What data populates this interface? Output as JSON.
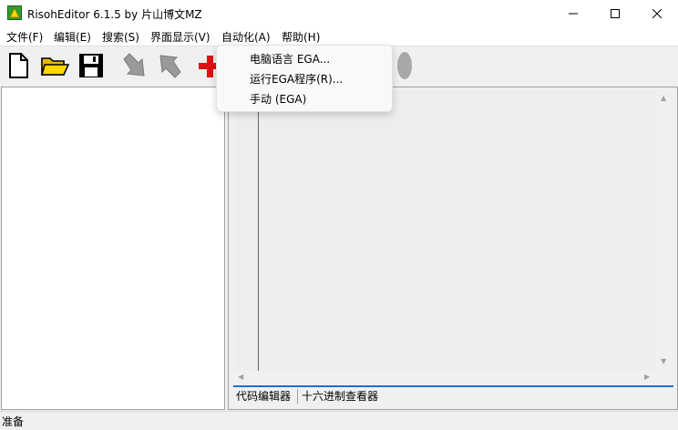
{
  "window": {
    "title": "RisohEditor 6.1.5 by 片山博文MZ",
    "icon": "app-icon",
    "controls": [
      "minimize-icon",
      "maximize-icon",
      "close-icon"
    ]
  },
  "menubar": {
    "items": [
      {
        "label": "文件(F)"
      },
      {
        "label": "编辑(E)"
      },
      {
        "label": "搜索(S)"
      },
      {
        "label": "界面显示(V)"
      },
      {
        "label": "自动化(A)"
      },
      {
        "label": "帮助(H)"
      }
    ]
  },
  "dropdown": {
    "items": [
      {
        "label": "电脑语言 EGA..."
      },
      {
        "label": "运行EGA程序(R)..."
      },
      {
        "label": "手动 (EGA)"
      }
    ]
  },
  "toolbar": {
    "buttons": [
      {
        "icon": "new-file-icon"
      },
      {
        "icon": "open-folder-icon"
      },
      {
        "icon": "save-icon"
      },
      {
        "icon": "import-icon"
      },
      {
        "icon": "export-icon"
      },
      {
        "icon": "add-icon"
      }
    ]
  },
  "tabs": [
    {
      "label": "代码编辑器"
    },
    {
      "label": "十六进制查看器"
    }
  ],
  "status": {
    "text": "准备"
  },
  "colors": {
    "accent": "#1e6fd0",
    "add": "#e01010"
  }
}
